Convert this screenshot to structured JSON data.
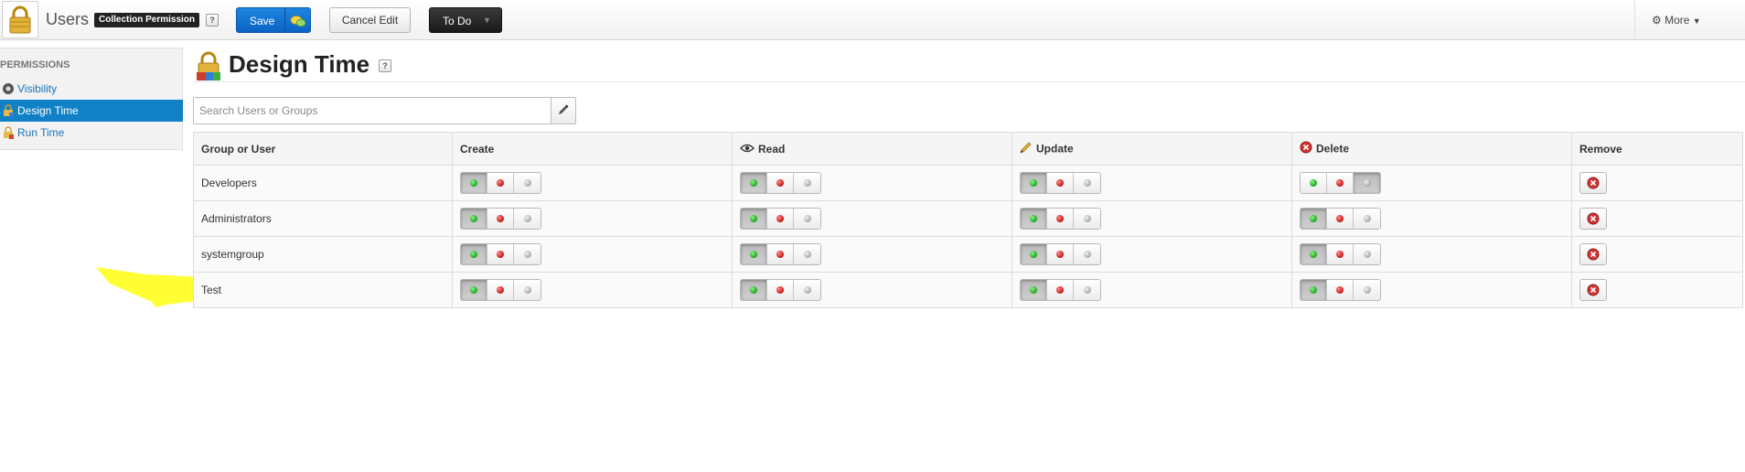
{
  "app": {
    "title": "Users",
    "badge": "Collection Permission",
    "help": "?"
  },
  "toolbar": {
    "save_label": "Save",
    "cancel_label": "Cancel Edit",
    "todo_label": "To Do",
    "more_label": "More"
  },
  "sidebar": {
    "heading": "PERMISSIONS",
    "items": [
      {
        "label": "Visibility",
        "icon": "eye-icon",
        "active": false
      },
      {
        "label": "Design Time",
        "icon": "lock-icon",
        "active": true
      },
      {
        "label": "Run Time",
        "icon": "lock-icon",
        "active": false
      }
    ]
  },
  "page": {
    "title": "Design Time",
    "help": "?"
  },
  "search": {
    "placeholder": "Search Users or Groups",
    "value": ""
  },
  "table": {
    "columns": [
      "Group or User",
      "Create",
      "Read",
      "Update",
      "Delete",
      "Remove"
    ],
    "state_icons": [
      "green-dot-icon",
      "red-dot-icon",
      "grey-dot-icon"
    ],
    "rows": [
      {
        "name": "Developers",
        "create": 0,
        "read": 0,
        "update": 0,
        "delete": 2
      },
      {
        "name": "Administrators",
        "create": 0,
        "read": 0,
        "update": 0,
        "delete": 0
      },
      {
        "name": "systemgroup",
        "create": 0,
        "read": 0,
        "update": 0,
        "delete": 0
      },
      {
        "name": "Test",
        "create": 0,
        "read": 0,
        "update": 0,
        "delete": 0
      }
    ]
  },
  "colors": {
    "accent_blue": "#1081c7",
    "save_blue": "#0a63c4",
    "todo_dark": "#1a1a1a",
    "highlight_yellow": "#ffff33"
  }
}
